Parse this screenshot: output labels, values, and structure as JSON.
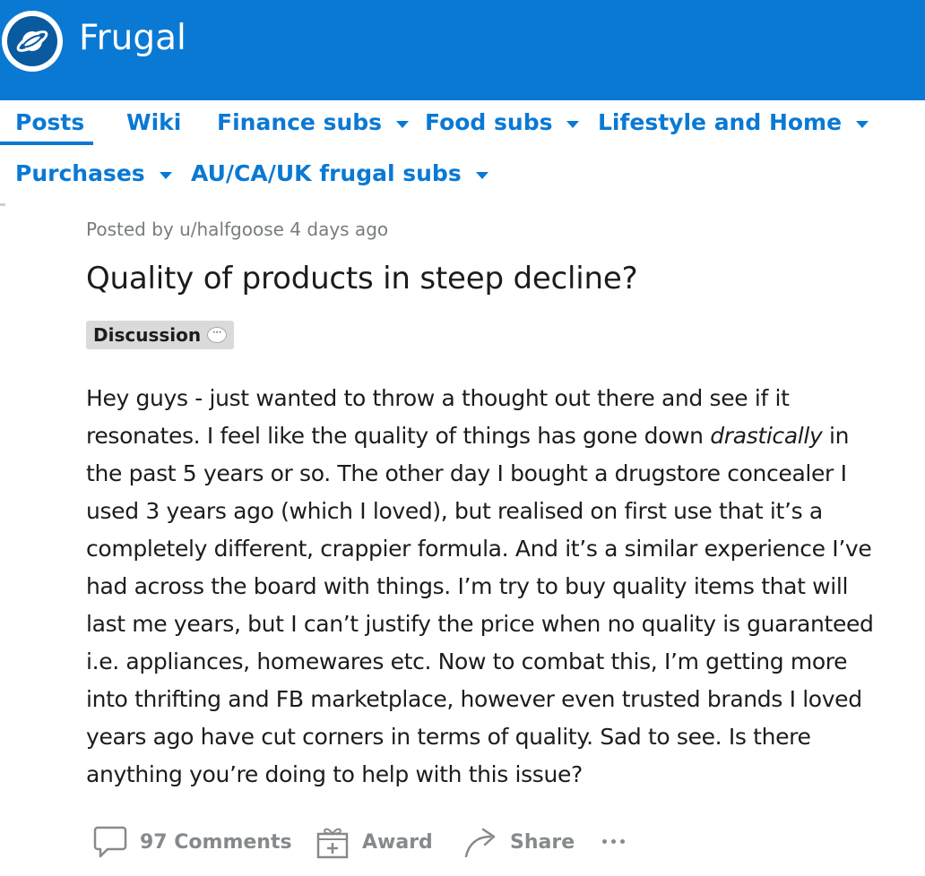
{
  "header": {
    "subreddit_name": "Frugal",
    "icon": "reddit-planet-icon",
    "colors": {
      "banner": "#0a79d4",
      "logo_inner": "#0a5aa0",
      "accent": "#0a79d4"
    }
  },
  "nav": {
    "active": "Posts",
    "items": [
      {
        "label": "Posts",
        "dropdown": false
      },
      {
        "label": "Wiki",
        "dropdown": false
      },
      {
        "label": "Finance subs",
        "dropdown": true
      },
      {
        "label": "Food subs",
        "dropdown": true
      },
      {
        "label": "Lifestyle and Home",
        "dropdown": true
      },
      {
        "label": "Purchases",
        "dropdown": true
      },
      {
        "label": "AU/CA/UK frugal subs",
        "dropdown": true
      }
    ]
  },
  "post": {
    "meta": "Posted by u/halfgoose 4 days ago",
    "title": "Quality of products in steep decline?",
    "flair": "Discussion",
    "flair_icon": "speech-bubble-icon",
    "body_lines": [
      "Hey guys - just wanted to throw a thought out there and see if it",
      "resonates. I feel like the quality of things has gone down ",
      "drastically",
      " in",
      "the past 5 years or so. The other day I bought a drugstore concealer I",
      "used 3 years ago (which I loved), but realised on first use that it’s a",
      "completely different, crappier formula. And it’s a similar experience I’ve",
      "had across the board with things. I’m try to buy quality items that will",
      "last me years, but I can’t justify the price when no quality is guaranteed",
      "i.e. appliances, homewares etc. Now to combat this, I’m getting more",
      "into thrifting and FB marketplace, however even trusted brands I loved",
      "years ago have cut corners in terms of quality. Sad to see. Is there",
      "anything you’re doing to help with this issue?"
    ]
  },
  "actions": {
    "comments_label": "97 Comments",
    "award_label": "Award",
    "share_label": "Share",
    "icons": [
      "comment-icon",
      "gift-icon",
      "share-icon",
      "more-icon"
    ]
  }
}
